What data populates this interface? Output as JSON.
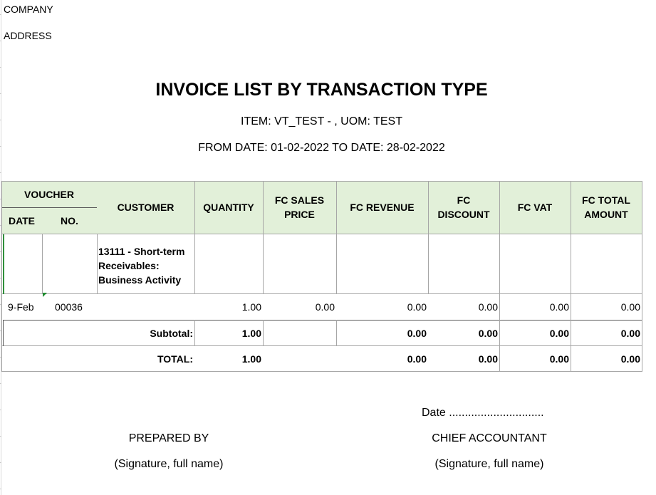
{
  "header": {
    "company": "COMPANY",
    "address": "ADDRESS",
    "title": "INVOICE LIST BY TRANSACTION TYPE",
    "subtitle": "ITEM: VT_TEST - , UOM: TEST",
    "date_range": "FROM DATE: 01-02-2022 TO DATE: 28-02-2022"
  },
  "table": {
    "columns": {
      "voucher": "VOUCHER",
      "date": "DATE",
      "no": "NO.",
      "customer": "CUSTOMER",
      "quantity": "QUANTITY",
      "fc_sales_price": "FC SALES PRICE",
      "fc_revenue": "FC REVENUE",
      "fc_discount": "FC DISCOUNT",
      "fc_vat": "FC VAT",
      "fc_total_amount": "FC TOTAL AMOUNT"
    },
    "group_label": "13111 - Short-term Receivables: Business Activity",
    "rows": [
      {
        "date": "9-Feb",
        "no": "00036",
        "customer": "",
        "quantity": "1.00",
        "fc_sales_price": "0.00",
        "fc_revenue": "0.00",
        "fc_discount": "0.00",
        "fc_vat": "0.00",
        "fc_total_amount": "0.00"
      }
    ],
    "subtotal": {
      "label": "Subtotal:",
      "quantity": "1.00",
      "fc_revenue": "0.00",
      "fc_discount": "0.00",
      "fc_vat": "0.00",
      "fc_total_amount": "0.00"
    },
    "total": {
      "label": "TOTAL:",
      "quantity": "1.00",
      "fc_revenue": "0.00",
      "fc_discount": "0.00",
      "fc_vat": "0.00",
      "fc_total_amount": "0.00"
    }
  },
  "footer": {
    "date_line": "Date ..............................",
    "prepared_by": "PREPARED BY",
    "prepared_signature": "(Signature, full name)",
    "chief_accountant": "CHIEF ACCOUNTANT",
    "chief_signature": "(Signature, full name)"
  },
  "colors": {
    "header_fill": "#e2f0d9",
    "grid_line": "#a6a6a6",
    "marker": "#1e8c2e"
  }
}
